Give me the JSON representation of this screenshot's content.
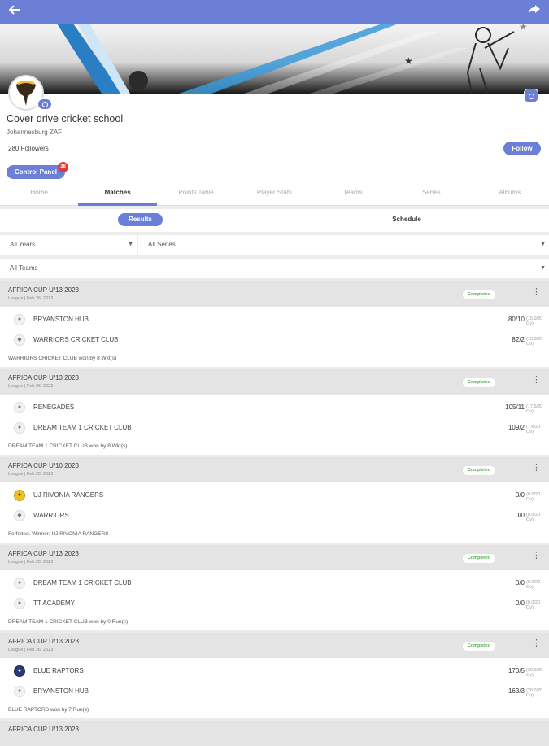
{
  "topbar": {
    "back_icon": "arrow-left-icon",
    "share_icon": "share-icon"
  },
  "profile": {
    "name": "Cover drive cricket school",
    "location": "Johannesburg ZAF",
    "followers": "280 Followers",
    "follow_label": "Follow",
    "control_panel_label": "Control Panel",
    "control_panel_badge": "38"
  },
  "tabs": [
    {
      "label": "Home",
      "active": false
    },
    {
      "label": "Matches",
      "active": true
    },
    {
      "label": "Points Table",
      "active": false
    },
    {
      "label": "Player Stats",
      "active": false
    },
    {
      "label": "Teams",
      "active": false
    },
    {
      "label": "Series",
      "active": false
    },
    {
      "label": "Albums",
      "active": false
    }
  ],
  "segments": {
    "results": "Results",
    "schedule": "Schedule"
  },
  "filters": {
    "years": "All Years",
    "series": "All Series",
    "teams": "All Teams"
  },
  "matches": [
    {
      "title": "AFRICA CUP U/13 2023",
      "sub": "League | Feb 26, 2023",
      "status": "Completed",
      "teams": [
        {
          "name": "BRYANSTON HUB",
          "score": "80/10",
          "overs": "(15.0/20 Ov)"
        },
        {
          "name": "WARRIORS CRICKET CLUB",
          "score": "82/2",
          "overs": "(10.0/20 Ov)"
        }
      ],
      "result": "WARRIORS CRICKET CLUB won by 8 Wkt(s)"
    },
    {
      "title": "AFRICA CUP U/13 2023",
      "sub": "League | Feb 26, 2023",
      "status": "Completed",
      "teams": [
        {
          "name": "RENEGADES",
          "score": "105/11",
          "overs": "(17.5/20 Ov)"
        },
        {
          "name": "DREAM TEAM 1 CRICKET CLUB",
          "score": "109/2",
          "overs": "(7.6/20 Ov)"
        }
      ],
      "result": "DREAM TEAM 1 CRICKET CLUB won by 8 Wkt(s)"
    },
    {
      "title": "AFRICA CUP U/10 2023",
      "sub": "League | Feb 26, 2023",
      "status": "Completed",
      "teams": [
        {
          "name": "UJ RIVONIA RANGERS",
          "score": "0/0",
          "overs": "(0.0/20 Ov)"
        },
        {
          "name": "WARRIORS",
          "score": "0/0",
          "overs": "(0.0/20 Ov)"
        }
      ],
      "result": "Forfeited. Winner: UJ RIVONIA RANGERS"
    },
    {
      "title": "AFRICA CUP U/13 2023",
      "sub": "League | Feb 26, 2023",
      "status": "Completed",
      "teams": [
        {
          "name": "DREAM TEAM 1 CRICKET CLUB",
          "score": "0/0",
          "overs": "(0.0/20 Ov)"
        },
        {
          "name": "TT ACADEMY",
          "score": "0/0",
          "overs": "(0.0/20 Ov)"
        }
      ],
      "result": "DREAM TEAM 1 CRICKET CLUB won by 0 Run(s)"
    },
    {
      "title": "AFRICA CUP U/13 2023",
      "sub": "League | Feb 26, 2023",
      "status": "Completed",
      "teams": [
        {
          "name": "BLUE RAPTORS",
          "score": "170/5",
          "overs": "(20.0/20 Ov)"
        },
        {
          "name": "BRYANSTON HUB",
          "score": "163/3",
          "overs": "(20.0/20 Ov)"
        }
      ],
      "result": "BLUE RAPTORS won by 7 Run(s)"
    },
    {
      "title": "AFRICA CUP U/13 2023",
      "sub": "",
      "status": "",
      "teams": [],
      "result": ""
    }
  ],
  "colors": {
    "accent": "#6b7fd7",
    "completed": "#4caf50",
    "badge": "#e53935"
  }
}
